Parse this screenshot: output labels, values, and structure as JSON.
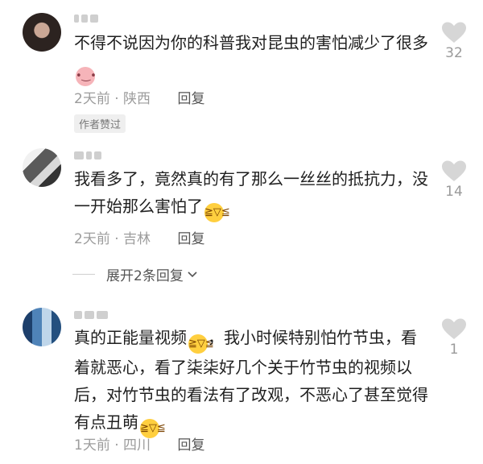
{
  "comments": [
    {
      "text": "不得不说因为你的科普我对昆虫的害怕减少了很多",
      "emoji": "pig",
      "time": "2天前",
      "location": "陕西",
      "reply_label": "回复",
      "badge": "作者赞过",
      "likes": "32"
    },
    {
      "text": "我看多了，竟然真的有了那么一丝丝的抵抗力，没一开始那么害怕了",
      "emoji": "laugh",
      "time": "2天前",
      "location": "吉林",
      "reply_label": "回复",
      "likes": "14"
    },
    {
      "text_part1": "真的正能量视频",
      "text_part2": "，我小时候特别怕竹节虫，看着就恶心，看了柒柒好几个关于竹节虫的视频以后，对竹节虫的看法有了改观，不恶心了甚至觉得有点丑萌",
      "emoji": "laugh",
      "time": "1天前",
      "location": "四川",
      "reply_label": "回复",
      "likes": "1"
    }
  ],
  "expand_replies_label": "展开2条回复",
  "colors": {
    "text": "#1f1f1f",
    "meta": "#9c9c9c",
    "heart": "#d6d6d6",
    "badge_bg": "#efefef"
  }
}
